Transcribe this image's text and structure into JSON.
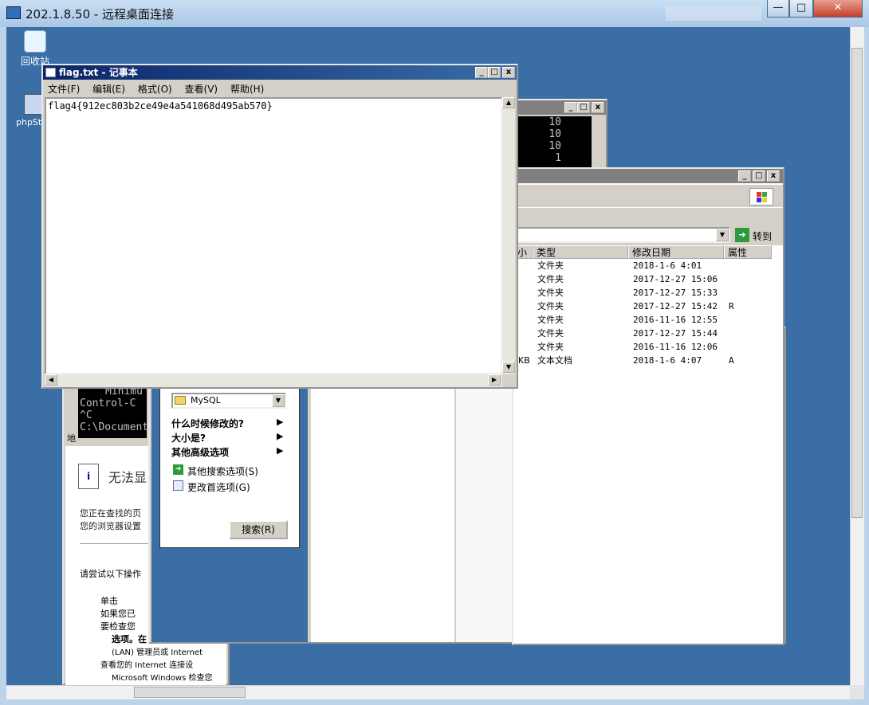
{
  "rdp": {
    "title": "202.1.8.50 - 远程桌面连接",
    "min": "—",
    "max": "□",
    "close": "✕"
  },
  "desktop_icons": [
    {
      "label": "回收站",
      "icon": "recycle-bin-icon"
    },
    {
      "label": "phpSt",
      "icon": "shortcut-icon"
    }
  ],
  "notepad": {
    "title": "flag.txt - 记事本",
    "menu": [
      "文件(F)",
      "编辑(E)",
      "格式(O)",
      "查看(V)",
      "帮助(H)"
    ],
    "content": "flag4{912ec803b2ce49e4a541068d495ab570}"
  },
  "console_top": {
    "lines": [
      "10",
      "10",
      "10",
      "1"
    ]
  },
  "console_bottom": {
    "lines": [
      "Minimu",
      "Control-C",
      "^C",
      "C:\\Document"
    ]
  },
  "explorer": {
    "goto_label": "转到",
    "columns": [
      "小",
      "类型",
      "修改日期",
      "属性"
    ],
    "rows": [
      {
        "size": "",
        "type": "文件夹",
        "date": "2018-1-6 4:01",
        "attr": ""
      },
      {
        "size": "",
        "type": "文件夹",
        "date": "2017-12-27 15:06",
        "attr": ""
      },
      {
        "size": "",
        "type": "文件夹",
        "date": "2017-12-27 15:33",
        "attr": ""
      },
      {
        "size": "",
        "type": "文件夹",
        "date": "2017-12-27 15:42",
        "attr": "R"
      },
      {
        "size": "",
        "type": "文件夹",
        "date": "2016-11-16 12:55",
        "attr": ""
      },
      {
        "size": "",
        "type": "文件夹",
        "date": "2017-12-27 15:44",
        "attr": ""
      },
      {
        "size": "",
        "type": "文件夹",
        "date": "2016-11-16 12:06",
        "attr": ""
      },
      {
        "size": "KB",
        "type": "文本文档",
        "date": "2018-1-6 4:07",
        "attr": "A"
      }
    ]
  },
  "search": {
    "location": "MySQL",
    "options": [
      "什么时候修改的?",
      "大小是?",
      "其他高级选项"
    ],
    "links": [
      "其他搜索选项(S)",
      "更改首选项(G)"
    ],
    "search_button": "搜索(R)"
  },
  "ie": {
    "address_label": "地",
    "heading": "无法显",
    "p1": "您正在查找的页",
    "p2": "您的浏览器设置",
    "try": "请尝试以下操作",
    "bullets": [
      "单击",
      "如果您已",
      "要检查您",
      "查看您的 Internet 连接设"
    ],
    "extra1": "选项。在",
    "extra2": "(LAN) 管理员或 Internet",
    "extra3": "Microsoft Windows 检查您"
  }
}
